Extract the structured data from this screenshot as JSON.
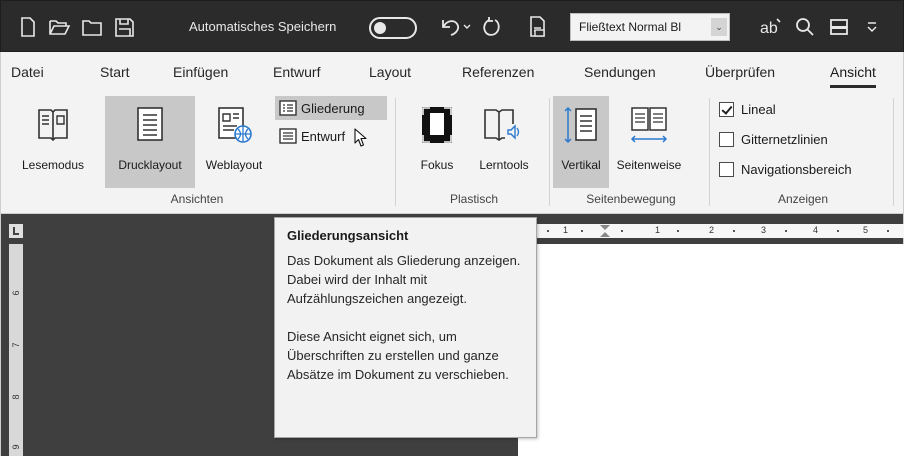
{
  "quick_access": {
    "autosave_label": "Automatisches Speichern",
    "style_value": "Fließtext Normal Bl",
    "icons": [
      "new-document-icon",
      "open-folder-icon",
      "folder-icon",
      "save-icon",
      "undo-icon",
      "redo-icon",
      "print-layout-icon",
      "format-painter-icon",
      "search-icon",
      "view-icon",
      "more-icon"
    ]
  },
  "tabs": [
    "Datei",
    "Start",
    "Einfügen",
    "Entwurf",
    "Layout",
    "Referenzen",
    "Sendungen",
    "Überprüfen",
    "Ansicht"
  ],
  "active_tab": "Ansicht",
  "ribbon": {
    "views": {
      "label": "Ansichten",
      "lesemodus": "Lesemodus",
      "drucklayout": "Drucklayout",
      "weblayout": "Weblayout",
      "gliederung": "Gliederung",
      "entwurf": "Entwurf"
    },
    "immersive": {
      "label": "Plastisch",
      "fokus": "Fokus",
      "lerntools": "Lerntools"
    },
    "page_movement": {
      "label": "Seitenbewegung",
      "vertikal": "Vertikal",
      "seitenweise": "Seitenweise"
    },
    "show": {
      "label": "Anzeigen",
      "lineal": "Lineal",
      "lineal_checked": true,
      "gitternetzlinien": "Gitternetzlinien",
      "gitternetzlinien_checked": false,
      "navigationsbereich": "Navigationsbereich",
      "navigationsbereich_checked": false
    }
  },
  "ruler": {
    "vertical_numbers": [
      "6",
      "7",
      "8",
      "9"
    ],
    "horizontal_numbers": [
      "1",
      "1",
      "2",
      "3",
      "4",
      "5"
    ]
  },
  "tooltip": {
    "title": "Gliederungsansicht",
    "paragraph1": "Das Dokument als Gliederung anzeigen. Dabei wird der Inhalt mit Aufzählungszeichen angezeigt.",
    "paragraph2": "Diese Ansicht eignet sich, um Überschriften zu erstellen und ganze Absätze im Dokument zu verschieben."
  },
  "colors": {
    "titlebar": "#2b2b2b",
    "ribbon": "#f3f3f3",
    "selected": "#c8c8c8",
    "doc_background": "#3f3f3f",
    "accent_blue": "#2b79d0"
  }
}
